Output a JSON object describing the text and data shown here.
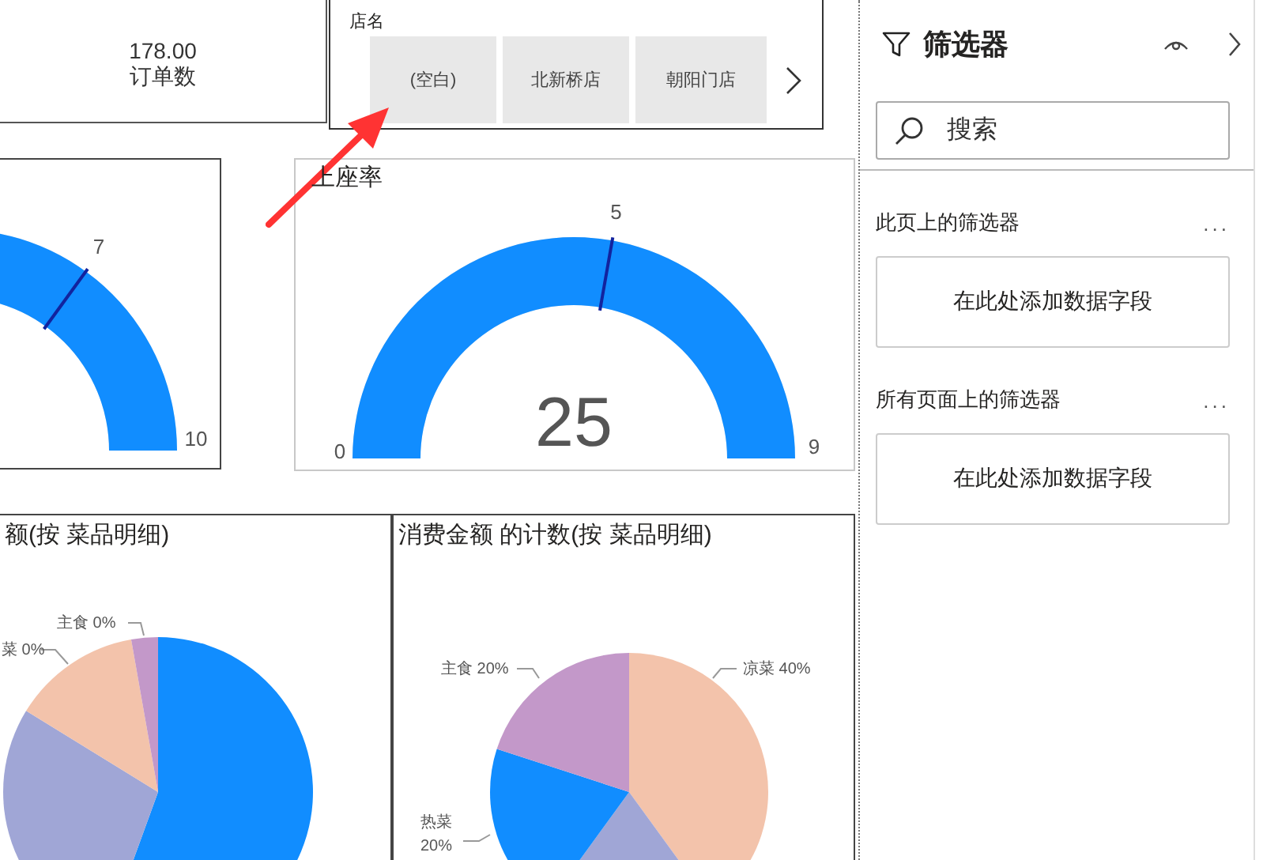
{
  "order_card": {
    "value": "178.00",
    "label": "订单数"
  },
  "slicer": {
    "title": "店名",
    "items": [
      {
        "label": "(空白)"
      },
      {
        "label": "北新桥店"
      },
      {
        "label": "朝阳门店"
      }
    ]
  },
  "gauges": [
    {
      "target": "7",
      "max": "10",
      "level": 1
    },
    {
      "title": "上座率",
      "min": "0",
      "max": "9",
      "target": "5",
      "value": "25",
      "level": 1
    }
  ],
  "pies": [
    {
      "title": "额(按 菜品明细)",
      "slices": [
        {
          "color": "#118dff"
        },
        {
          "color": "#a0a6d6"
        },
        {
          "color": "#f3c3ab",
          "label": "菜 0%"
        },
        {
          "color": "#c398c9",
          "label": "主食 0%"
        }
      ]
    },
    {
      "title": "消费金额 的计数(按 菜品明细)",
      "slices": [
        {
          "color": "#f3c3ab",
          "label": "凉菜 40%"
        },
        {
          "color": "#a0a6d6"
        },
        {
          "color": "#118dff",
          "label": "热菜 20%"
        },
        {
          "color": "#c398c9",
          "label": "主食 20%"
        }
      ]
    }
  ],
  "filter_pane": {
    "title": "筛选器",
    "search": {
      "placeholder": "搜索"
    },
    "sections": [
      {
        "title": "此页上的筛选器",
        "more": "...",
        "dropzone": "在此处添加数据字段"
      },
      {
        "title": "所有页面上的筛选器",
        "more": "...",
        "dropzone": "在此处添加数据字段"
      }
    ]
  }
}
